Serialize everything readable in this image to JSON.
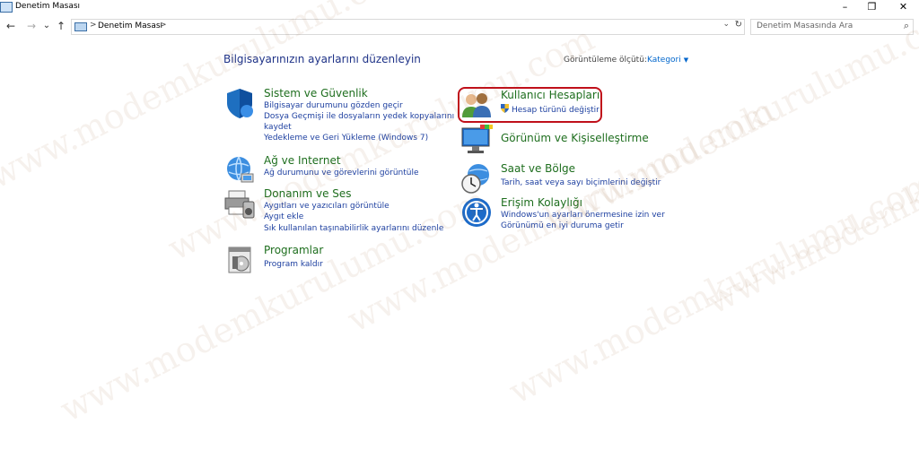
{
  "window": {
    "title": "Denetim Masası",
    "minimize": "–",
    "maximize": "❐",
    "close": "✕"
  },
  "nav": {
    "back": "←",
    "forward": "→",
    "recent": "⌄",
    "up": "↑"
  },
  "address": {
    "separator": ">",
    "crumb": "Denetim Masası",
    "separator_end": ">",
    "dropdown": "⌄",
    "refresh": "↻"
  },
  "search": {
    "placeholder": "Denetim Masasında Ara",
    "icon": "⌕"
  },
  "main": {
    "heading": "Bilgisayarınızın ayarlarını düzenleyin",
    "view_by_label": "Görüntüleme ölçütü:",
    "view_by_value": "Kategori",
    "view_by_arrow": "▼"
  },
  "categories": [
    {
      "title": "Sistem ve Güvenlik",
      "icon": "shield-icon",
      "links": [
        "Bilgisayar durumunu gözden geçir",
        "Dosya Geçmişi ile dosyaların yedek kopyalarını",
        "kaydet",
        "Yedekleme ve Geri Yükleme (Windows 7)"
      ]
    },
    {
      "title": "Ağ ve Internet",
      "icon": "globe-network-icon",
      "links": [
        "Ağ durumunu ve görevlerini görüntüle"
      ]
    },
    {
      "title": "Donanım ve Ses",
      "icon": "printer-speaker-icon",
      "links": [
        "Aygıtları ve yazıcıları görüntüle",
        "Aygıt ekle",
        "Sık kullanılan taşınabilirlik ayarlarını düzenle"
      ]
    },
    {
      "title": "Programlar",
      "icon": "programs-icon",
      "links": [
        "Program kaldır"
      ]
    },
    {
      "title": "Kullanıcı Hesapları",
      "icon": "users-icon",
      "links": [
        "Hesap türünü değiştir"
      ]
    },
    {
      "title": "Görünüm ve Kişiselleştirme",
      "icon": "monitor-palette-icon",
      "links": []
    },
    {
      "title": "Saat ve Bölge",
      "icon": "clock-globe-icon",
      "links": [
        "Tarih, saat veya sayı biçimlerini değiştir"
      ]
    },
    {
      "title": "Erişim Kolaylığı",
      "icon": "accessibility-icon",
      "links": [
        "Windows'un ayarları önermesine izin ver",
        "Görünümü en iyi duruma getir"
      ]
    }
  ],
  "watermark": "www.modemkurulumu.com",
  "colors": {
    "category_title": "#1e6e1e",
    "link": "#1e40a0",
    "heading": "#1e3287",
    "highlight": "#c0101a"
  }
}
